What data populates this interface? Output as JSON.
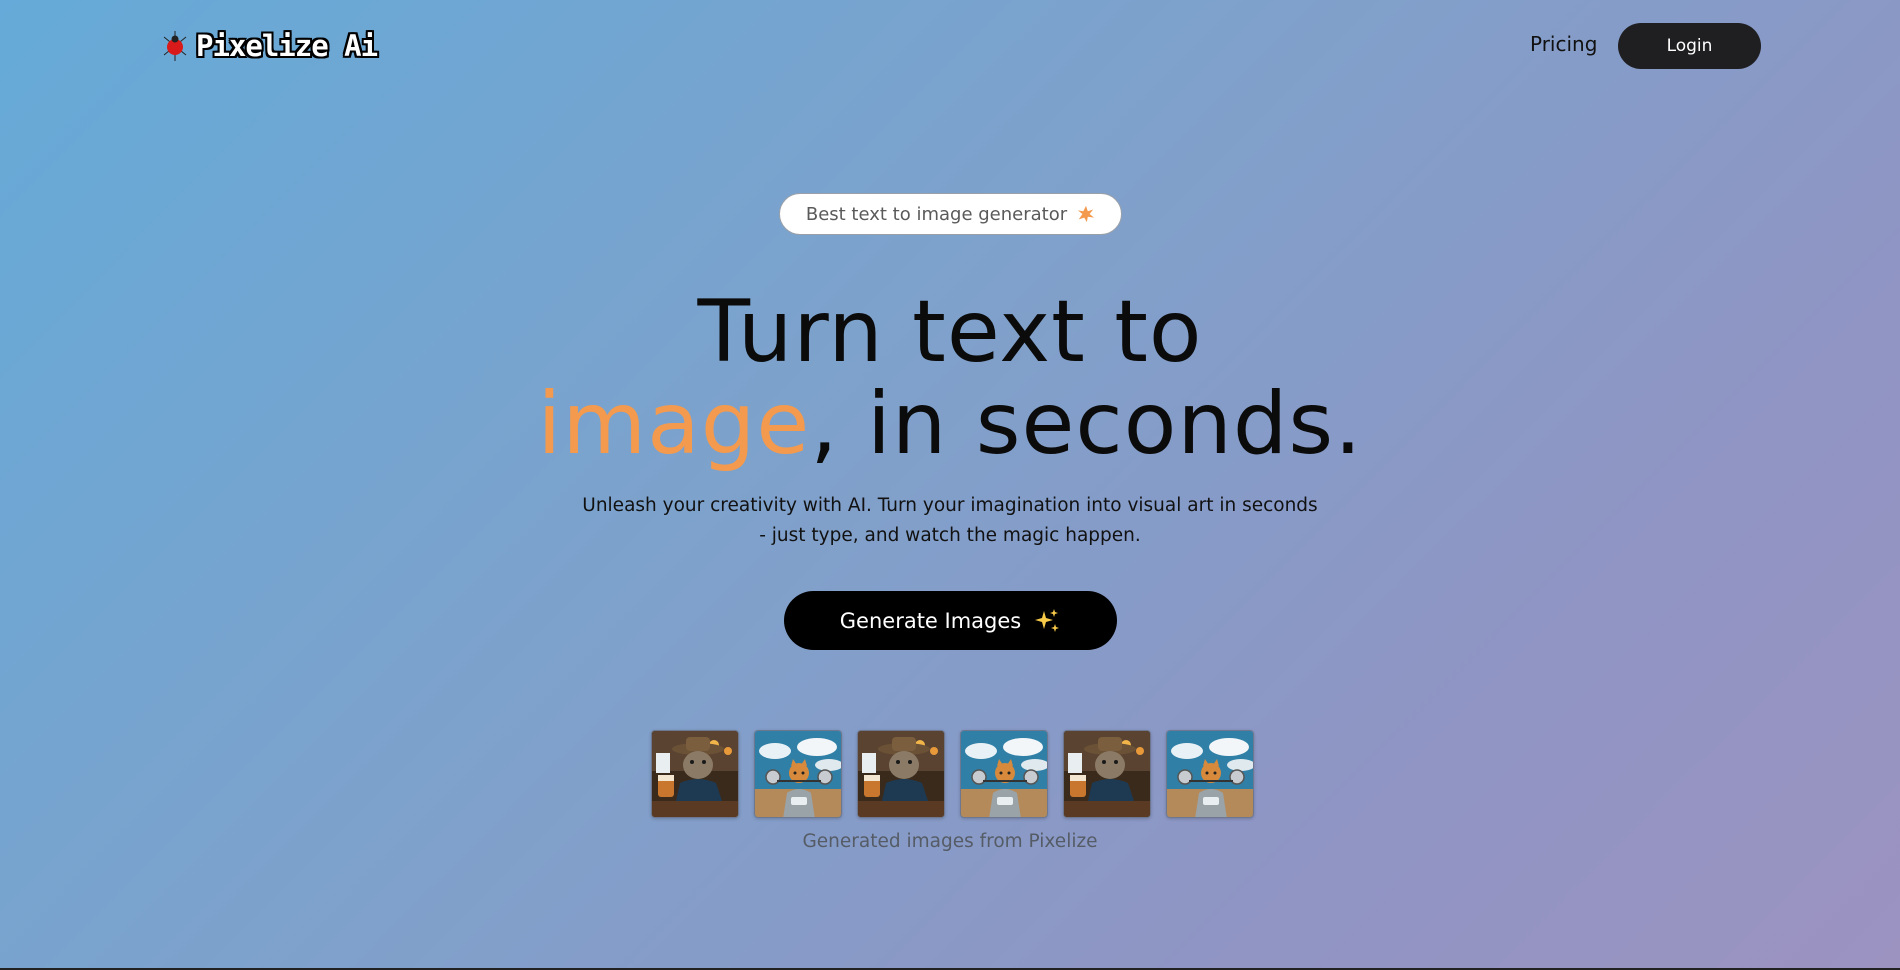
{
  "header": {
    "brand": "Pixelize Ai",
    "nav_pricing": "Pricing",
    "login_label": "Login"
  },
  "badge": {
    "text": "Best text to image generator",
    "icon": "star-burst-icon"
  },
  "hero": {
    "line1": "Turn text to",
    "accent_word": "image",
    "line2_rest": ", in seconds.",
    "subtitle": "Unleash your creativity with AI. Turn your imagination into visual art in seconds - just type, and watch the magic happen."
  },
  "cta": {
    "label": "Generate Images",
    "icon": "sparkles-icon"
  },
  "gallery": {
    "images": [
      "cat-cowboy-tea",
      "cat-scooter",
      "cat-cowboy-tea",
      "cat-scooter",
      "cat-cowboy-tea",
      "cat-scooter"
    ],
    "caption": "Generated images from Pixelize"
  },
  "colors": {
    "accent": "#f39a4f",
    "button_dark": "#000000",
    "login_dark": "#1f1f22"
  }
}
